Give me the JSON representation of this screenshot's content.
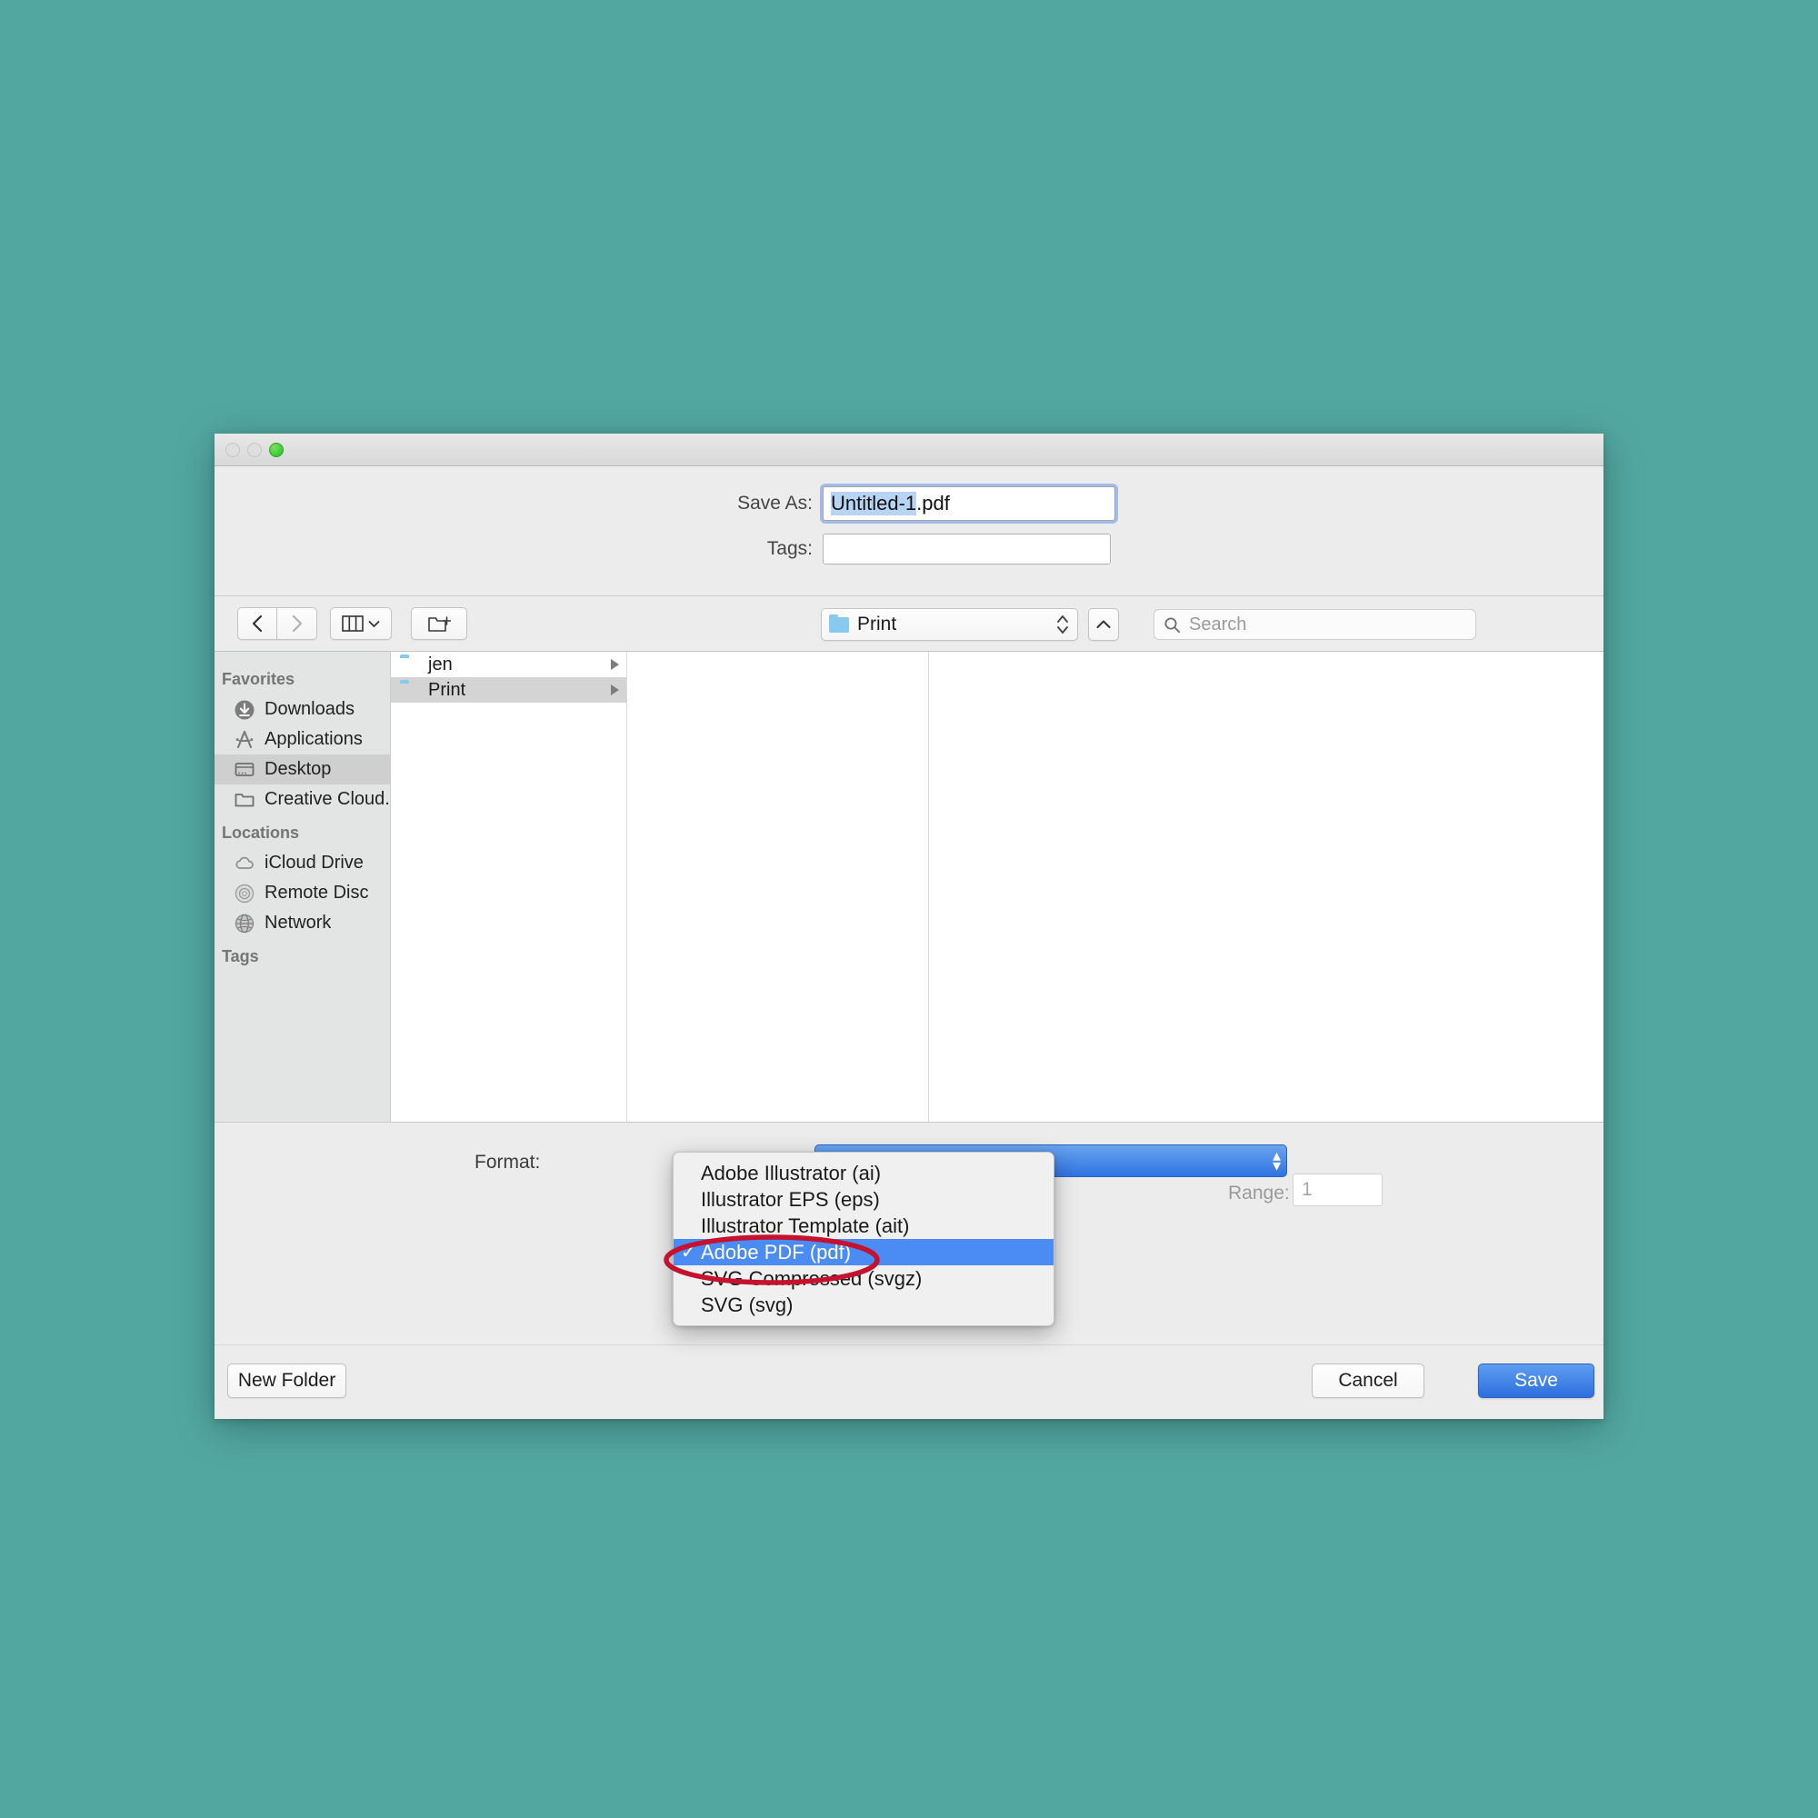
{
  "desktop": {
    "background_color": "#52a8a1"
  },
  "window": {
    "traffic_lights": {
      "close": "close",
      "minimize": "minimize",
      "zoom": "zoom"
    }
  },
  "fields": {
    "save_as_label": "Save As:",
    "save_as_value_selected": "Untitled-1",
    "save_as_value_rest": ".pdf",
    "tags_label": "Tags:",
    "tags_value": ""
  },
  "toolbar": {
    "back_icon": "chevron-left-icon",
    "forward_icon": "chevron-right-icon",
    "view_icon": "column-view-icon",
    "view_chevron_icon": "chevron-down-icon",
    "new_folder_icon": "new-folder-icon",
    "path_value": "Print",
    "path_folder_icon": "folder-icon",
    "path_stepper_icon": "stepper-updown-icon",
    "up_icon": "chevron-up-icon",
    "search_icon": "search-icon",
    "search_placeholder": "Search"
  },
  "sidebar": {
    "sections": [
      {
        "title": "Favorites",
        "items": [
          {
            "label": "Downloads",
            "icon": "downloads-icon",
            "selected": false
          },
          {
            "label": "Applications",
            "icon": "applications-icon",
            "selected": false
          },
          {
            "label": "Desktop",
            "icon": "desktop-icon",
            "selected": true
          },
          {
            "label": "Creative Cloud...",
            "icon": "folder-icon",
            "selected": false
          }
        ]
      },
      {
        "title": "Locations",
        "items": [
          {
            "label": "iCloud Drive",
            "icon": "cloud-icon",
            "selected": false
          },
          {
            "label": "Remote Disc",
            "icon": "disc-icon",
            "selected": false
          },
          {
            "label": "Network",
            "icon": "globe-icon",
            "selected": false
          }
        ]
      },
      {
        "title": "Tags",
        "items": []
      }
    ]
  },
  "browser": {
    "column1": [
      {
        "name": "jen",
        "icon": "folder-icon",
        "has_children": true,
        "selected": false
      },
      {
        "name": "Print",
        "icon": "folder-icon",
        "has_children": true,
        "selected": true
      }
    ],
    "column2": [],
    "column3": []
  },
  "accessory": {
    "format_label": "Format:",
    "format_value": "Adobe PDF (pdf)",
    "range_label": "Range:",
    "range_value": "1"
  },
  "buttons": {
    "new_folder": "New Folder",
    "cancel": "Cancel",
    "save": "Save"
  },
  "format_menu": {
    "checkmark": "✓",
    "items": [
      {
        "label": "Adobe Illustrator (ai)",
        "checked": false,
        "selected": false
      },
      {
        "label": "Illustrator EPS (eps)",
        "checked": false,
        "selected": false
      },
      {
        "label": "Illustrator Template (ait)",
        "checked": false,
        "selected": false
      },
      {
        "label": "Adobe PDF (pdf)",
        "checked": true,
        "selected": true
      },
      {
        "label": "SVG Compressed (svgz)",
        "checked": false,
        "selected": false
      },
      {
        "label": "SVG (svg)",
        "checked": false,
        "selected": false
      }
    ]
  },
  "annotation": {
    "shape": "ellipse",
    "color": "#c4122f",
    "stroke_width": 5,
    "target": "Adobe PDF (pdf)"
  },
  "colors": {
    "desktop": "#52a8a1",
    "accent_blue": "#4b8bf4",
    "selection_blue": "#b8d4f5",
    "annotation_red": "#c4122f",
    "window_chrome": "#ececec"
  }
}
